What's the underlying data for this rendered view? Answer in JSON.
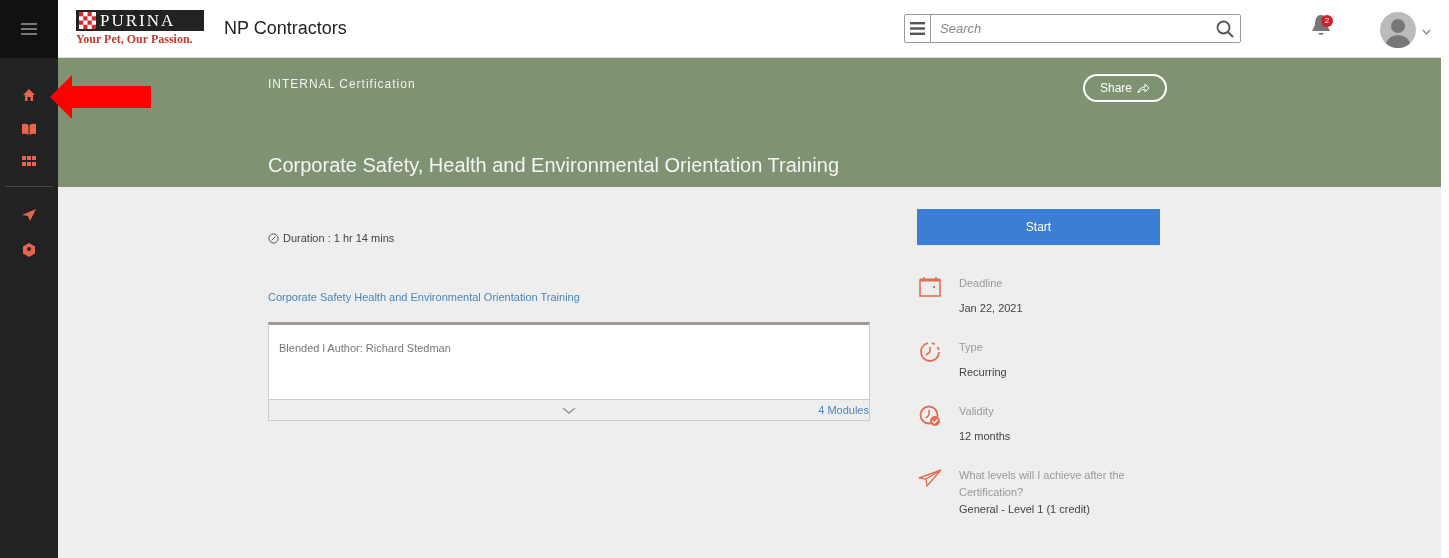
{
  "header": {
    "logo": {
      "wordmark": "PURINA",
      "tagline": "Your Pet, Our Passion."
    },
    "site_title": "NP Contractors",
    "search": {
      "placeholder": "Search"
    },
    "notifications": {
      "count": "2"
    }
  },
  "banner": {
    "category": "INTERNAL Certification",
    "share_label": "Share",
    "title": "Corporate Safety, Health and Environmental Orientation Training"
  },
  "details": {
    "duration": "Duration : 1 hr 14 mins",
    "course_link": "Corporate Safety Health and Environmental Orientation Training",
    "card": {
      "meta": "Blended l Author: Richard Stedman",
      "modules": "4 Modules"
    }
  },
  "start_button": "Start",
  "facts": [
    {
      "kind": "deadline",
      "label": "Deadline",
      "value": "Jan 22, 2021"
    },
    {
      "kind": "type",
      "label": "Type",
      "value": "Recurring"
    },
    {
      "kind": "validity",
      "label": "Validity",
      "value": "12 months"
    },
    {
      "kind": "levels",
      "label": "What levels will I achieve after the Certification?",
      "value": "General - Level 1 (1 credit)"
    }
  ]
}
